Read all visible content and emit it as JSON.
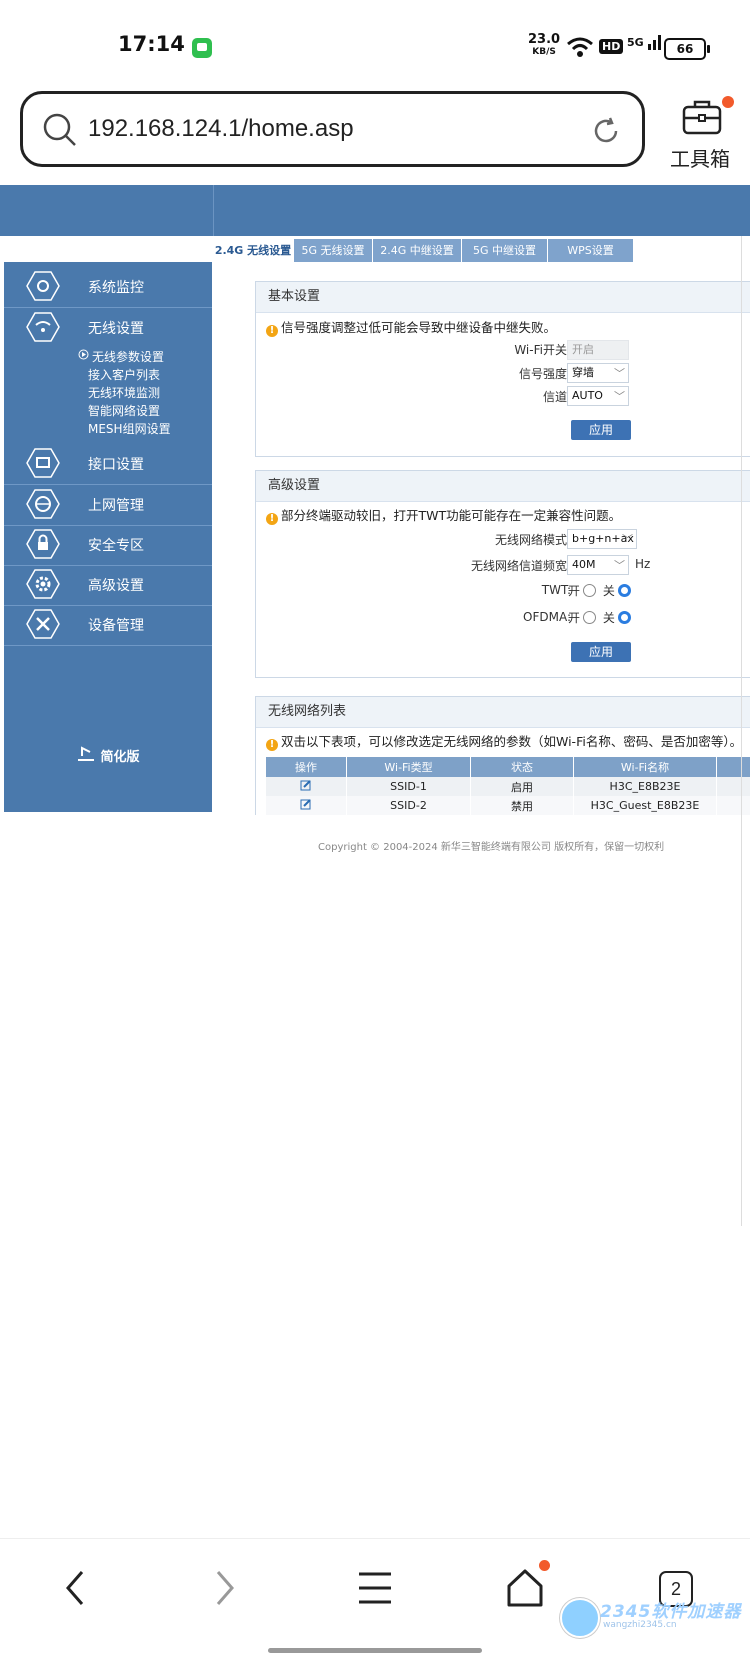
{
  "status_bar": {
    "time": "17:14",
    "speed_value": "23.0",
    "speed_unit": "KB/S",
    "hd_label": "HD",
    "signal_label": "5G",
    "battery": "66"
  },
  "browser": {
    "url": "192.168.124.1/home.asp",
    "toolbox_label": "工具箱"
  },
  "tabs": [
    "2.4G 无线设置",
    "5G 无线设置",
    "2.4G 中继设置",
    "5G 中继设置",
    "WPS设置"
  ],
  "sidebar": {
    "items": [
      "系统监控",
      "无线设置",
      "接口设置",
      "上网管理",
      "安全专区",
      "高级设置",
      "设备管理"
    ],
    "sub_items": [
      "无线参数设置",
      "接入客户列表",
      "无线环境监测",
      "智能网络设置",
      "MESH组网设置"
    ],
    "simple_label": "简化版"
  },
  "basic": {
    "title": "基本设置",
    "warning": "信号强度调整过低可能会导致中继设备中继失败。",
    "wifi_label": "Wi-Fi开关:",
    "wifi_value": "开启",
    "signal_label": "信号强度:",
    "signal_value": "穿墙",
    "channel_label": "信道:",
    "channel_value": "AUTO",
    "apply": "应用"
  },
  "advanced": {
    "title": "高级设置",
    "warning": "部分终端驱动较旧，打开TWT功能可能存在一定兼容性问题。",
    "mode_label": "无线网络模式:",
    "mode_value": "b+g+n+ax",
    "bandwidth_label": "无线网络信道频宽:",
    "bandwidth_value": "40M",
    "bandwidth_unit": "Hz",
    "twt_label": "TWT:",
    "ofdma_label": "OFDMA:",
    "on_label": "开",
    "off_label": "关",
    "apply": "应用"
  },
  "network_list": {
    "title": "无线网络列表",
    "warning": "双击以下表项，可以修改选定无线网络的参数（如Wi-Fi名称、密码、是否加密等）。",
    "headers": [
      "操作",
      "Wi-Fi类型",
      "状态",
      "Wi-Fi名称"
    ],
    "rows": [
      {
        "type": "SSID-1",
        "status": "启用",
        "name": "H3C_E8B23E"
      },
      {
        "type": "SSID-2",
        "status": "禁用",
        "name": "H3C_Guest_E8B23E"
      }
    ]
  },
  "copyright": "Copyright © 2004-2024 新华三智能终端有限公司 版权所有，保留一切权利",
  "bottom_nav": {
    "tab_count": "2"
  },
  "watermark": {
    "text": "2345软件加速器",
    "sub": "wangzhi2345.cn"
  }
}
